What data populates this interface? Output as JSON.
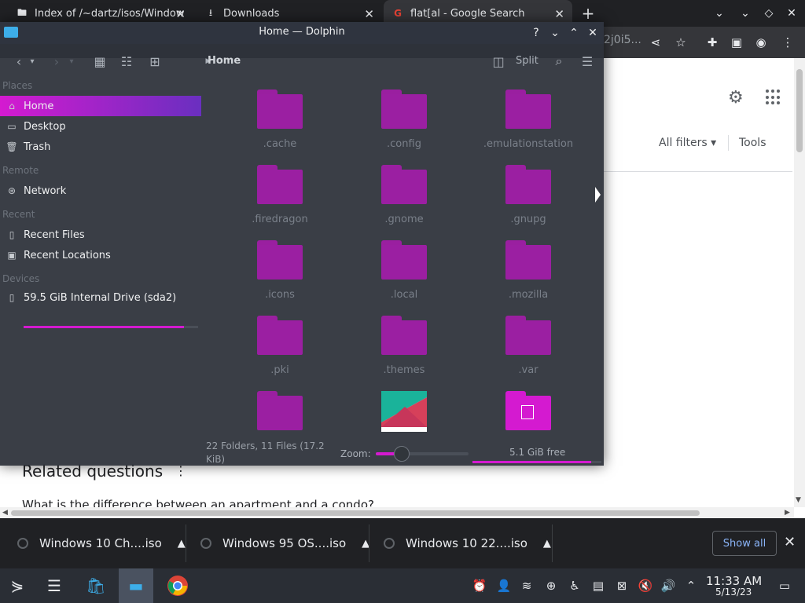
{
  "browser": {
    "tabs": [
      {
        "title": "Index of /~dartz/isos/Window",
        "icon": "file-icon"
      },
      {
        "title": "Downloads",
        "icon": "download-icon"
      },
      {
        "title": "flat[al - Google Search",
        "icon": "google-icon"
      }
    ],
    "url_fragment": "2j0i5...",
    "page": {
      "all_filters": "All filters",
      "tools": "Tools",
      "related_questions": "Related questions",
      "question_1": "What is the difference between an apartment and a condo?"
    }
  },
  "dolphin": {
    "title": "Home — Dolphin",
    "toolbar": {
      "breadcrumb": "Home",
      "split_label": "Split"
    },
    "places": {
      "sections": [
        {
          "header": "Places",
          "items": [
            "Home",
            "Desktop",
            "Trash"
          ]
        },
        {
          "header": "Remote",
          "items": [
            "Network"
          ]
        },
        {
          "header": "Recent",
          "items": [
            "Recent Files",
            "Recent Locations"
          ]
        },
        {
          "header": "Devices",
          "items": [
            "59.5 GiB Internal Drive (sda2)"
          ]
        }
      ],
      "selected": "Home",
      "drive_usage_fraction": 0.92
    },
    "folders": [
      ".cache",
      ".config",
      ".emulationstation",
      ".firedragon",
      ".gnome",
      ".gnupg",
      ".icons",
      ".local",
      ".mozilla",
      ".pki",
      ".themes",
      ".var"
    ],
    "status": {
      "summary": "22 Folders, 11 Files (17.2 KiB)",
      "zoom_label": "Zoom:",
      "free_space": "5.1 GiB free",
      "free_usage_fraction": 0.92
    }
  },
  "downloads": [
    {
      "name": "Windows 10 Ch....iso"
    },
    {
      "name": "Windows 95 OS....iso"
    },
    {
      "name": "Windows 10 22....iso"
    }
  ],
  "download_shelf": {
    "show_all": "Show all"
  },
  "clock": {
    "time": "11:33 AM",
    "date": "5/13/23"
  },
  "colors": {
    "accent": "#d41ad0",
    "folder": "#9b1fa2",
    "panel": "#2e323a"
  }
}
